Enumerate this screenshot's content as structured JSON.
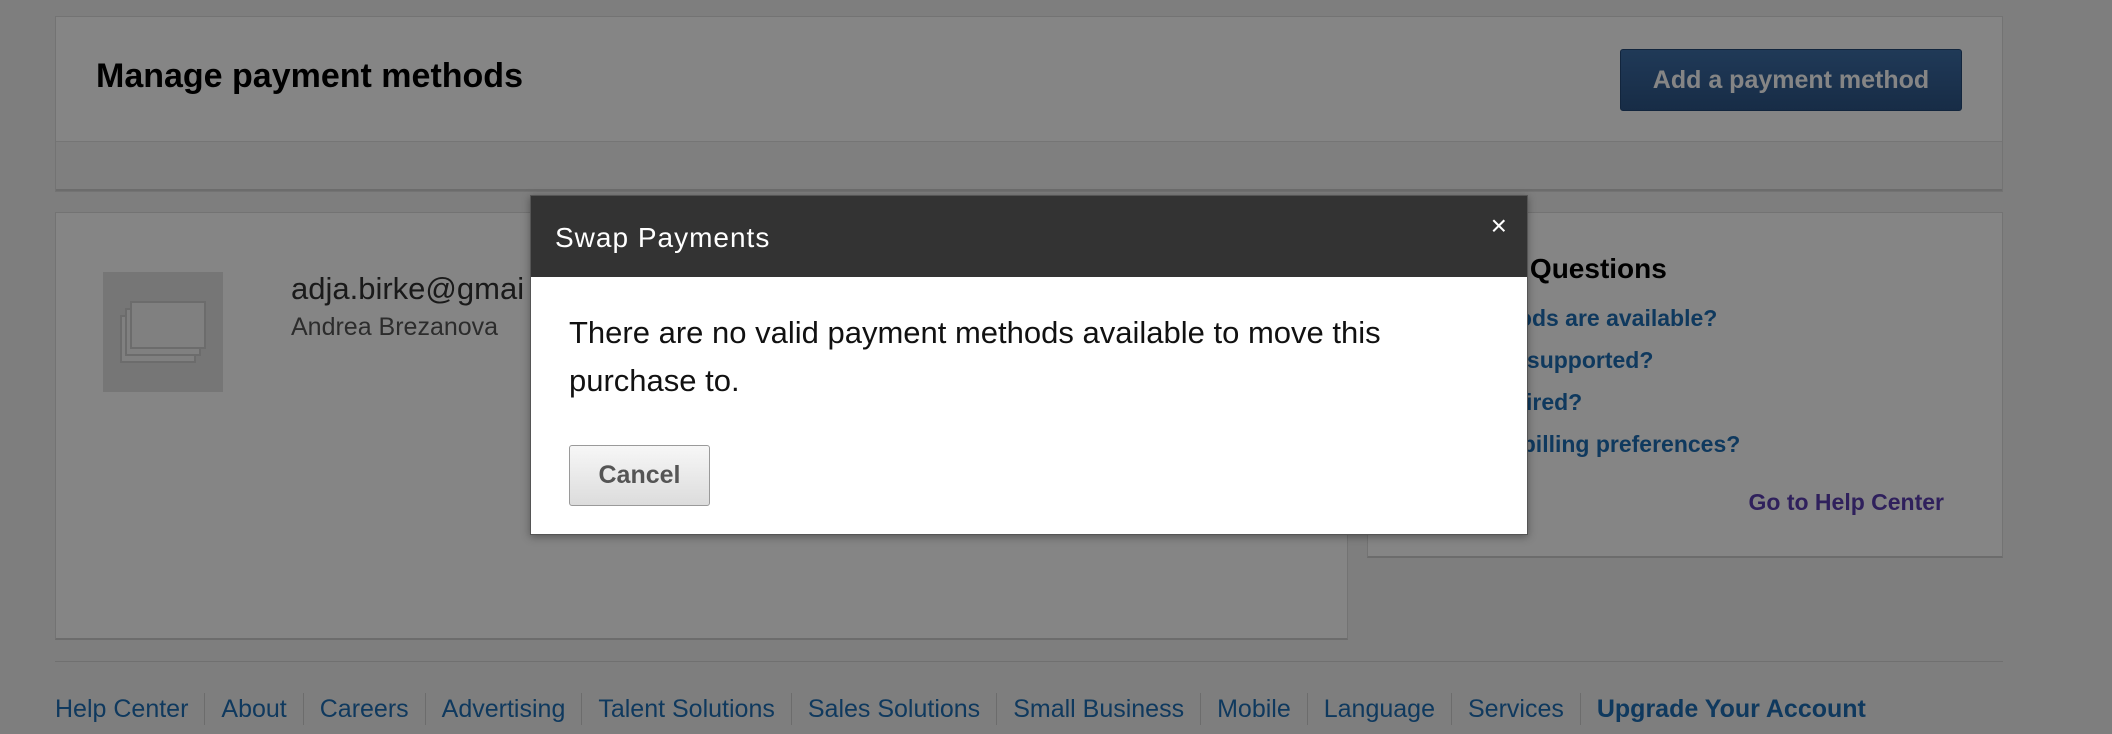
{
  "header": {
    "title": "Manage payment methods",
    "add_button_label": "Add a payment method"
  },
  "payment_card": {
    "email": "adja.birke@gmai",
    "name": "Andrea Brezanova",
    "thumbnail_icon": "money-bills-icon"
  },
  "faq": {
    "title": "ly Asked Questions",
    "links": [
      "nent methods are available?",
      "encies are supported?",
      "VAT # required?",
      "hange my billing preferences?"
    ],
    "help_center_label": "Go to Help Center"
  },
  "footer": {
    "links": [
      "Help Center",
      "About",
      "Careers",
      "Advertising",
      "Talent Solutions",
      "Sales Solutions",
      "Small Business",
      "Mobile",
      "Language",
      "Services",
      "Upgrade Your Account"
    ]
  },
  "modal": {
    "title": "Swap Payments",
    "close_symbol": "×",
    "message": "There are no valid payment methods available to move this purchase to.",
    "cancel_label": "Cancel"
  },
  "colors": {
    "primary_button": "#2d5587",
    "link": "#1e6db4",
    "help_link": "#5a3eb0",
    "modal_header": "#333333"
  }
}
